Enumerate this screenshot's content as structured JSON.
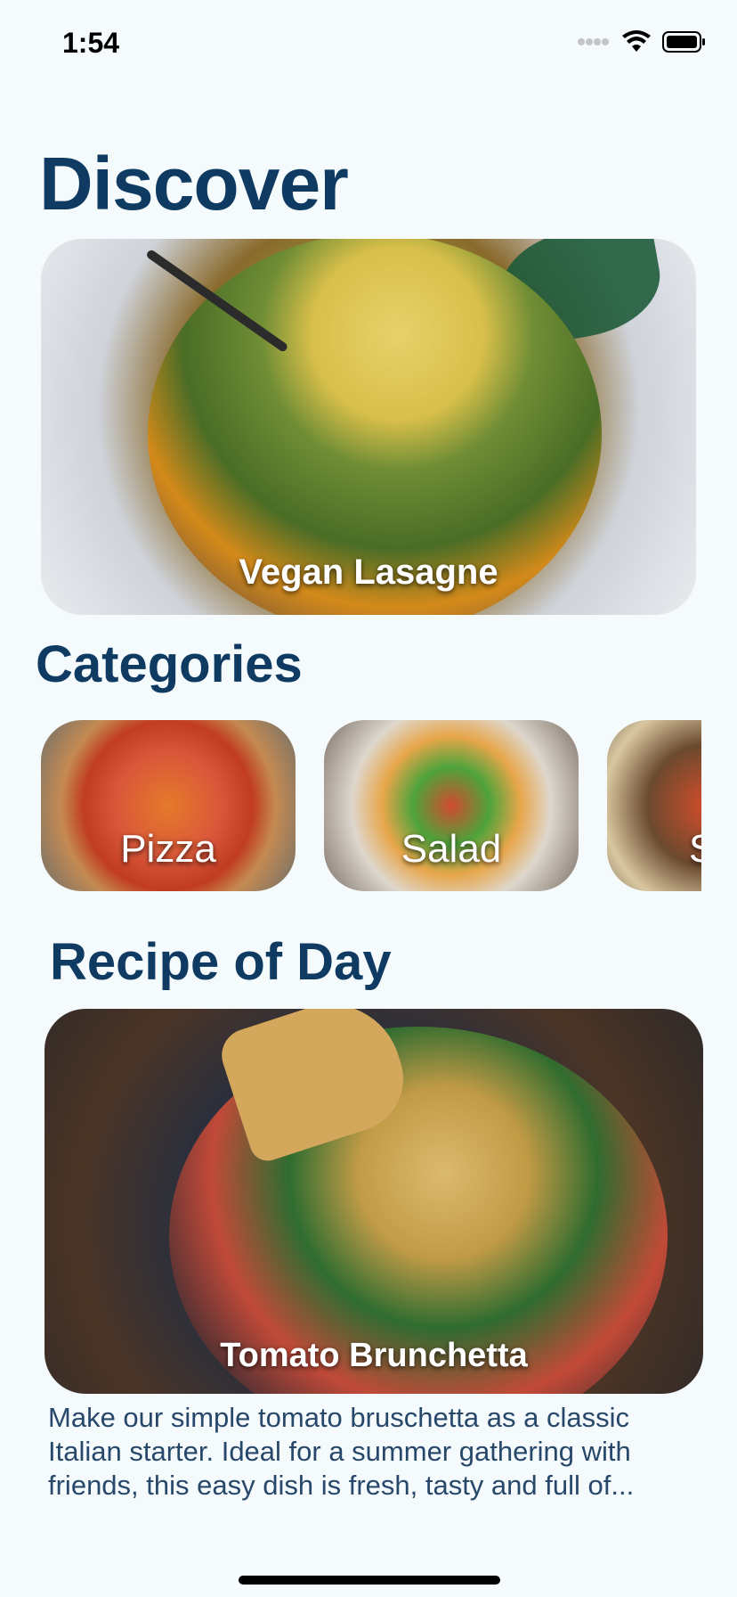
{
  "status": {
    "time": "1:54",
    "icons": [
      "cellular-dots-icon",
      "wifi-icon",
      "battery-icon"
    ]
  },
  "header": {
    "title": "Discover"
  },
  "featured": {
    "title": "Vegan Lasagne"
  },
  "categories": {
    "title": "Categories",
    "items": [
      {
        "label": "Pizza"
      },
      {
        "label": "Salad"
      },
      {
        "label": "S"
      }
    ]
  },
  "recipe_of_day": {
    "title": "Recipe of Day",
    "card_title": "Tomato Brunchetta",
    "description": "Make our simple tomato bruschetta as a classic Italian starter. Ideal for a summer gathering with friends, this easy dish is fresh, tasty and full of..."
  },
  "colors": {
    "background": "#f5fbfd",
    "heading": "#0f3a61",
    "body_text": "#27486a"
  }
}
